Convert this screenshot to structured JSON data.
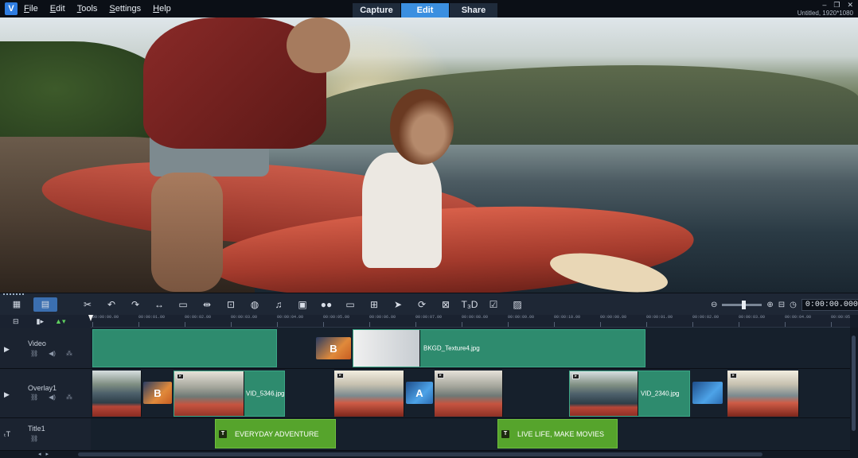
{
  "app": {
    "menu": [
      "File",
      "Edit",
      "Tools",
      "Settings",
      "Help"
    ],
    "mode_tabs": [
      {
        "label": "Capture",
        "active": false
      },
      {
        "label": "Edit",
        "active": true
      },
      {
        "label": "Share",
        "active": false
      }
    ],
    "window_controls": {
      "minimize": "–",
      "restore": "❐",
      "close": "✕"
    },
    "project_info": "Untitled, 1920*1080"
  },
  "toolbar": {
    "views": [
      {
        "icon": "storyboard-view-icon",
        "glyph": "▦",
        "active": false
      },
      {
        "icon": "timeline-view-icon",
        "glyph": "▤",
        "active": true
      }
    ],
    "tools": [
      {
        "icon": "tools-icon",
        "glyph": "✂"
      },
      {
        "icon": "undo-icon",
        "glyph": "↶"
      },
      {
        "icon": "redo-icon",
        "glyph": "↷"
      },
      {
        "icon": "fit-project-icon",
        "glyph": "↔"
      },
      {
        "icon": "pan-zoom-icon",
        "glyph": "▭"
      },
      {
        "icon": "split-icon",
        "glyph": "⇹"
      },
      {
        "icon": "crop-icon",
        "glyph": "⊡"
      },
      {
        "icon": "color-icon",
        "glyph": "◍"
      },
      {
        "icon": "audio-mixer-icon",
        "glyph": "♫"
      },
      {
        "icon": "multi-camera-icon",
        "glyph": "▣"
      },
      {
        "icon": "mask-icon",
        "glyph": "●●"
      },
      {
        "icon": "subtitle-icon",
        "glyph": "▭"
      },
      {
        "icon": "split-screen-icon",
        "glyph": "⊞"
      },
      {
        "icon": "motion-icon",
        "glyph": "➤"
      },
      {
        "icon": "rotate-icon",
        "glyph": "⟳"
      },
      {
        "icon": "stabilize-icon",
        "glyph": "⊠"
      },
      {
        "icon": "3d-title-icon",
        "glyph": "T₃D"
      },
      {
        "icon": "check-icon",
        "glyph": "☑"
      },
      {
        "icon": "image-icon",
        "glyph": "▨"
      }
    ],
    "zoom": {
      "out_glyph": "⊖",
      "in_glyph": "⊕",
      "fit_glyph": "⊟",
      "clock_glyph": "◷",
      "level": 0.55
    },
    "timecode": "0:00:00.000"
  },
  "timeline": {
    "ruler_ticks": [
      "00:00:00.00",
      "00:00:01.00",
      "00:00:02.00",
      "00:00:03.00",
      "00:00:04.00",
      "00:00:05.00",
      "00:00:06.00",
      "00:00:07.00",
      "00:00:08.00",
      "00:00:09.00",
      "00:00:10.00",
      "00:00:00.00",
      "00:00:01.00",
      "00:00:02.00",
      "00:00:03.00",
      "00:00:04.00",
      "00:00:05.00"
    ],
    "tracks": [
      {
        "name": "Video",
        "icon": "video-track-icon",
        "glyph": "▶"
      },
      {
        "name": "Overlay1",
        "icon": "overlay-track-icon",
        "glyph": "▶"
      },
      {
        "name": "Title1",
        "icon": "title-track-icon",
        "glyph": "ₜT"
      }
    ],
    "video_clip_label": "BKGD_Texture4.jpg",
    "transition_b": "B",
    "transition_a": "A",
    "overlay_clip_1": "VID_5346.jpg",
    "overlay_clip_2": "VID_2340.jpg",
    "title_clips": [
      "EVERYDAY ADVENTURE",
      "LIVE LIFE, MAKE MOVIES"
    ],
    "title_badge": "T"
  },
  "colors": {
    "accent": "#3b8fe0",
    "video_clip": "#2e8b6e",
    "title_clip": "#56a42c"
  }
}
